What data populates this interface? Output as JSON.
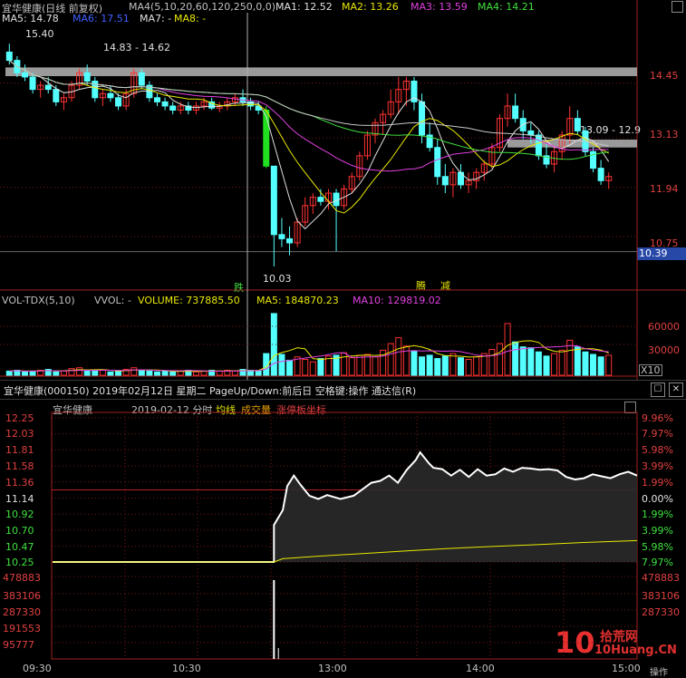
{
  "kline": {
    "title": "宜华健康(日线 前复权)",
    "ma_setting": "MA4(5,10,20,60,120,250,0,0)",
    "ma1": "MA1: 12.52",
    "ma2": "MA2: 13.26",
    "ma3": "MA3: 13.59",
    "ma4": "MA4: 14.21",
    "ma5": "MA5: 14.78",
    "ma6": "MA6: 17.51",
    "ma7": "MA7: -",
    "ma8": "MA8: -",
    "y_labels": [
      "14.45",
      "13.13",
      "11.94",
      "10.75"
    ],
    "current_price": "10.39",
    "high_label": "15.40",
    "low_label": "10.03",
    "range_label_top": "14.83 - 14.62",
    "range_label_mid": "13.09 - 12.9",
    "marker_fall": "跌",
    "marker_a": "腾",
    "marker_b": "减"
  },
  "volume": {
    "name": "VOL-TDX(5,10)",
    "vvol": "VVOL: -",
    "vol": "VOLUME: 737885.50",
    "ma5": "MA5: 184870.23",
    "ma10": "MA10: 129819.02",
    "y_labels": [
      "60000",
      "30000"
    ],
    "unit": "X10"
  },
  "timeshare_window": {
    "title": "宜华健康(000150)  2019年02月12日  星期二  PageUp/Down:前后日  空格键:操作  通达信(R)",
    "btn_max": "☐",
    "btn_close": "✕",
    "stock": "宜华健康",
    "datetime": "2019-02-12 分时",
    "avg_label": "均线",
    "vol_label": "成交量",
    "limit_label": "涨停板坐标",
    "left_prices": [
      "12.25",
      "12.03",
      "11.81",
      "11.58",
      "11.36",
      "11.14",
      "10.92",
      "10.70",
      "10.47",
      "10.25"
    ],
    "right_pct": [
      "9.96%",
      "7.97%",
      "5.98%",
      "3.99%",
      "1.99%",
      "0.00%",
      "1.99%",
      "3.99%",
      "5.98%",
      "7.97%"
    ],
    "vol_labels": [
      "478883",
      "383106",
      "287330",
      "191553",
      "95777"
    ],
    "times": [
      "09:30",
      "10:30",
      "13:00",
      "14:00",
      "15:00"
    ],
    "watermark_text": "拾荒网",
    "watermark_url": "10Huang.CN",
    "watermark_prefix": "10",
    "corner": "操作"
  },
  "chart_data": [
    {
      "type": "candlestick",
      "title": "宜华健康(日线 前复权)",
      "ylim": [
        9.9,
        15.8
      ],
      "series": [
        {
          "name": "MA1",
          "last": 12.52
        },
        {
          "name": "MA2",
          "last": 13.26
        },
        {
          "name": "MA3",
          "last": 13.59
        },
        {
          "name": "MA4",
          "last": 14.21
        },
        {
          "name": "MA5",
          "last": 14.78
        },
        {
          "name": "MA6",
          "last": 17.51
        }
      ],
      "ohlc": [
        [
          15.2,
          15.4,
          14.9,
          15.0
        ],
        [
          15.0,
          15.1,
          14.6,
          14.7
        ],
        [
          14.7,
          14.9,
          14.5,
          14.6
        ],
        [
          14.6,
          14.7,
          14.2,
          14.3
        ],
        [
          14.3,
          14.5,
          14.1,
          14.4
        ],
        [
          14.4,
          14.6,
          14.2,
          14.3
        ],
        [
          14.3,
          14.4,
          13.9,
          14.0
        ],
        [
          14.0,
          14.2,
          13.8,
          14.1
        ],
        [
          14.1,
          14.5,
          14.0,
          14.4
        ],
        [
          14.4,
          14.8,
          14.3,
          14.7
        ],
        [
          14.7,
          14.9,
          14.4,
          14.5
        ],
        [
          14.5,
          14.6,
          14.0,
          14.1
        ],
        [
          14.1,
          14.3,
          13.9,
          14.2
        ],
        [
          14.2,
          14.4,
          14.0,
          14.1
        ],
        [
          14.1,
          14.2,
          13.8,
          13.9
        ],
        [
          13.9,
          14.3,
          13.8,
          14.2
        ],
        [
          14.2,
          14.8,
          14.1,
          14.7
        ],
        [
          14.7,
          14.8,
          14.3,
          14.4
        ],
        [
          14.4,
          14.5,
          14.0,
          14.1
        ],
        [
          14.1,
          14.2,
          13.9,
          14.0
        ],
        [
          14.0,
          14.1,
          13.8,
          13.9
        ],
        [
          13.9,
          14.0,
          13.7,
          13.8
        ],
        [
          13.8,
          14.0,
          13.7,
          13.9
        ],
        [
          13.9,
          14.0,
          13.7,
          13.8
        ],
        [
          13.8,
          14.0,
          13.7,
          13.9
        ],
        [
          13.9,
          14.1,
          13.8,
          14.0
        ],
        [
          14.0,
          14.1,
          13.8,
          13.85
        ],
        [
          13.85,
          14.0,
          13.75,
          13.9
        ],
        [
          13.9,
          14.1,
          13.8,
          14.0
        ],
        [
          14.0,
          14.2,
          13.9,
          14.1
        ],
        [
          14.1,
          14.3,
          13.9,
          14.0
        ],
        [
          14.0,
          14.1,
          13.8,
          13.9
        ],
        [
          13.9,
          14.0,
          13.7,
          13.8
        ],
        [
          13.8,
          13.9,
          12.4,
          12.45
        ],
        [
          12.45,
          12.45,
          10.03,
          10.8
        ],
        [
          10.8,
          11.2,
          10.5,
          10.7
        ],
        [
          10.7,
          11.0,
          10.3,
          10.6
        ],
        [
          10.6,
          11.2,
          10.5,
          11.1
        ],
        [
          11.1,
          11.7,
          11.0,
          11.5
        ],
        [
          11.5,
          11.8,
          11.3,
          11.7
        ],
        [
          11.7,
          11.9,
          11.5,
          11.6
        ],
        [
          11.6,
          11.9,
          11.4,
          11.8
        ],
        [
          11.8,
          11.9,
          10.4,
          11.5
        ],
        [
          11.5,
          12.0,
          11.4,
          11.9
        ],
        [
          11.9,
          12.3,
          11.8,
          12.2
        ],
        [
          12.2,
          12.8,
          12.1,
          12.7
        ],
        [
          12.7,
          13.3,
          12.6,
          13.2
        ],
        [
          13.2,
          13.6,
          13.0,
          13.5
        ],
        [
          13.5,
          13.8,
          13.2,
          13.7
        ],
        [
          13.7,
          14.3,
          13.6,
          14.0
        ],
        [
          14.0,
          14.6,
          13.7,
          14.3
        ],
        [
          14.3,
          14.6,
          13.9,
          14.5
        ],
        [
          14.5,
          14.6,
          13.8,
          14.0
        ],
        [
          14.0,
          14.2,
          13.0,
          13.2
        ],
        [
          13.2,
          13.5,
          12.8,
          12.9
        ],
        [
          12.9,
          13.1,
          12.0,
          12.2
        ],
        [
          12.2,
          12.5,
          11.8,
          12.0
        ],
        [
          12.0,
          12.4,
          11.7,
          12.3
        ],
        [
          12.3,
          12.5,
          11.9,
          12.0
        ],
        [
          12.0,
          12.3,
          11.8,
          12.1
        ],
        [
          12.1,
          12.4,
          11.9,
          12.3
        ],
        [
          12.3,
          12.6,
          12.1,
          12.5
        ],
        [
          12.5,
          13.0,
          12.4,
          12.9
        ],
        [
          12.9,
          13.7,
          12.8,
          13.6
        ],
        [
          13.6,
          14.2,
          13.4,
          13.9
        ],
        [
          13.9,
          14.2,
          13.5,
          13.6
        ],
        [
          13.6,
          13.8,
          13.1,
          13.3
        ],
        [
          13.3,
          13.5,
          13.0,
          13.2
        ],
        [
          13.2,
          13.3,
          12.6,
          12.7
        ],
        [
          12.7,
          13.0,
          12.4,
          12.5
        ],
        [
          12.5,
          12.9,
          12.3,
          12.8
        ],
        [
          12.8,
          13.3,
          12.6,
          13.2
        ],
        [
          13.2,
          13.9,
          13.0,
          13.6
        ],
        [
          13.6,
          13.8,
          13.2,
          13.3
        ],
        [
          13.3,
          13.4,
          12.7,
          12.8
        ],
        [
          12.8,
          12.9,
          12.3,
          12.4
        ],
        [
          12.4,
          12.6,
          12.0,
          12.1
        ],
        [
          12.1,
          12.3,
          11.9,
          12.2
        ]
      ]
    },
    {
      "type": "bar",
      "title": "VOL-TDX(5,10)",
      "values": [
        5,
        6,
        4,
        5,
        6,
        7,
        4,
        5,
        8,
        9,
        6,
        5,
        6,
        4,
        5,
        7,
        9,
        6,
        5,
        4,
        5,
        4,
        5,
        6,
        4,
        5,
        6,
        5,
        6,
        5,
        7,
        6,
        5,
        26,
        74,
        25,
        18,
        22,
        19,
        16,
        20,
        23,
        24,
        27,
        21,
        24,
        25,
        22,
        30,
        38,
        45,
        35,
        29,
        22,
        24,
        20,
        23,
        26,
        21,
        19,
        22,
        26,
        31,
        38,
        62,
        40,
        34,
        33,
        28,
        23,
        26,
        30,
        42,
        34,
        28,
        25,
        22,
        24
      ],
      "ylim": [
        0,
        75000
      ]
    },
    {
      "type": "line",
      "title": "2019-02-12 分时",
      "times": [
        "09:30",
        "10:30",
        "13:00",
        "14:00",
        "15:00"
      ],
      "ylim": [
        10.03,
        12.25
      ],
      "prev_close": 11.14,
      "series": [
        {
          "name": "price_segments",
          "values": [
            [
              0,
              10.03
            ],
            [
              0.5,
              10.03
            ],
            [
              0.5,
              10.6
            ],
            [
              0.52,
              10.83
            ],
            [
              0.53,
              11.2
            ],
            [
              0.545,
              11.36
            ],
            [
              0.56,
              11.22
            ],
            [
              0.58,
              11.05
            ],
            [
              0.6,
              11.0
            ],
            [
              0.62,
              11.06
            ],
            [
              0.65,
              11.0
            ],
            [
              0.68,
              11.05
            ],
            [
              0.7,
              11.15
            ],
            [
              0.72,
              11.25
            ],
            [
              0.74,
              11.28
            ],
            [
              0.76,
              11.36
            ],
            [
              0.78,
              11.25
            ],
            [
              0.8,
              11.45
            ],
            [
              0.82,
              11.6
            ],
            [
              0.83,
              11.72
            ],
            [
              0.85,
              11.55
            ],
            [
              0.86,
              11.48
            ],
            [
              0.88,
              11.46
            ],
            [
              0.9,
              11.36
            ],
            [
              0.92,
              11.45
            ],
            [
              0.94,
              11.34
            ],
            [
              0.96,
              11.46
            ],
            [
              0.98,
              11.36
            ],
            [
              1.0,
              11.38
            ],
            [
              1.02,
              11.47
            ],
            [
              1.04,
              11.42
            ],
            [
              1.06,
              11.48
            ],
            [
              1.08,
              11.47
            ],
            [
              1.1,
              11.45
            ],
            [
              1.12,
              11.46
            ],
            [
              1.14,
              11.44
            ],
            [
              1.16,
              11.34
            ],
            [
              1.18,
              11.3
            ],
            [
              1.2,
              11.32
            ],
            [
              1.22,
              11.38
            ],
            [
              1.24,
              11.35
            ],
            [
              1.26,
              11.32
            ],
            [
              1.28,
              11.38
            ],
            [
              1.3,
              11.42
            ],
            [
              1.32,
              11.36
            ]
          ]
        },
        {
          "name": "avg_segments",
          "values": [
            [
              0,
              10.03
            ],
            [
              0.5,
              10.03
            ],
            [
              0.52,
              10.08
            ],
            [
              0.6,
              10.12
            ],
            [
              0.7,
              10.16
            ],
            [
              0.8,
              10.2
            ],
            [
              0.9,
              10.24
            ],
            [
              1.0,
              10.27
            ],
            [
              1.1,
              10.3
            ],
            [
              1.2,
              10.33
            ],
            [
              1.32,
              10.36
            ]
          ]
        }
      ]
    }
  ]
}
